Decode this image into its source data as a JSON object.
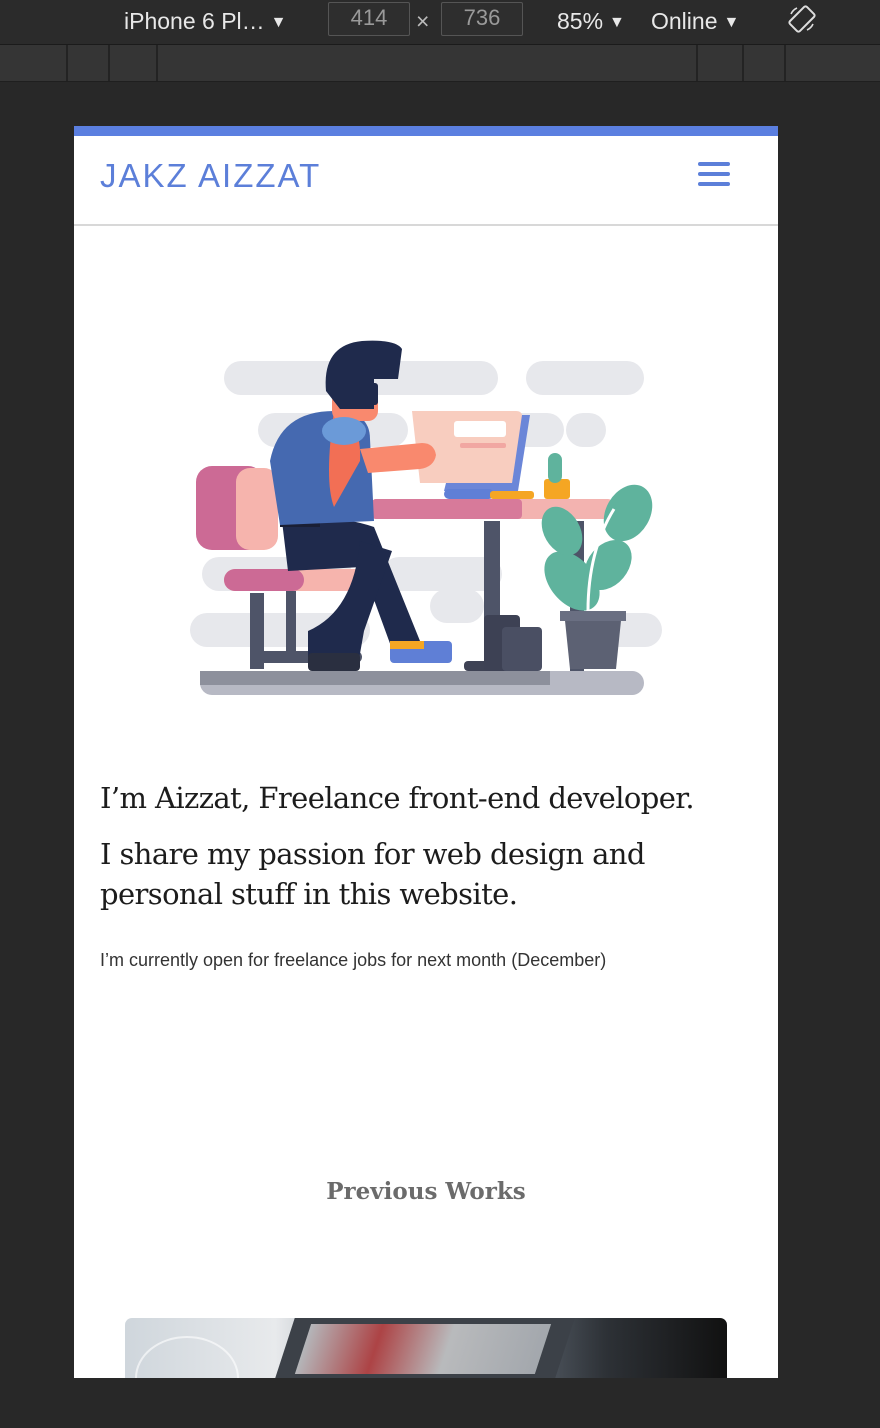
{
  "devtools": {
    "device": "iPhone 6 Pl…",
    "width": "414",
    "times": "×",
    "height": "736",
    "zoom": "85%",
    "network": "Online"
  },
  "site": {
    "brand": "JAKZ AIZZAT",
    "headline": "I’m Aizzat, Freelance front-end developer.",
    "subheadline": "I share my passion for web design and personal stuff in this website.",
    "note": "I’m currently open for freelance jobs for next month (December)",
    "section_title": "Previous Works"
  },
  "colors": {
    "accent": "#5b7fe0",
    "text": "#1c1c1c",
    "chrome": "#2b2b2b"
  }
}
